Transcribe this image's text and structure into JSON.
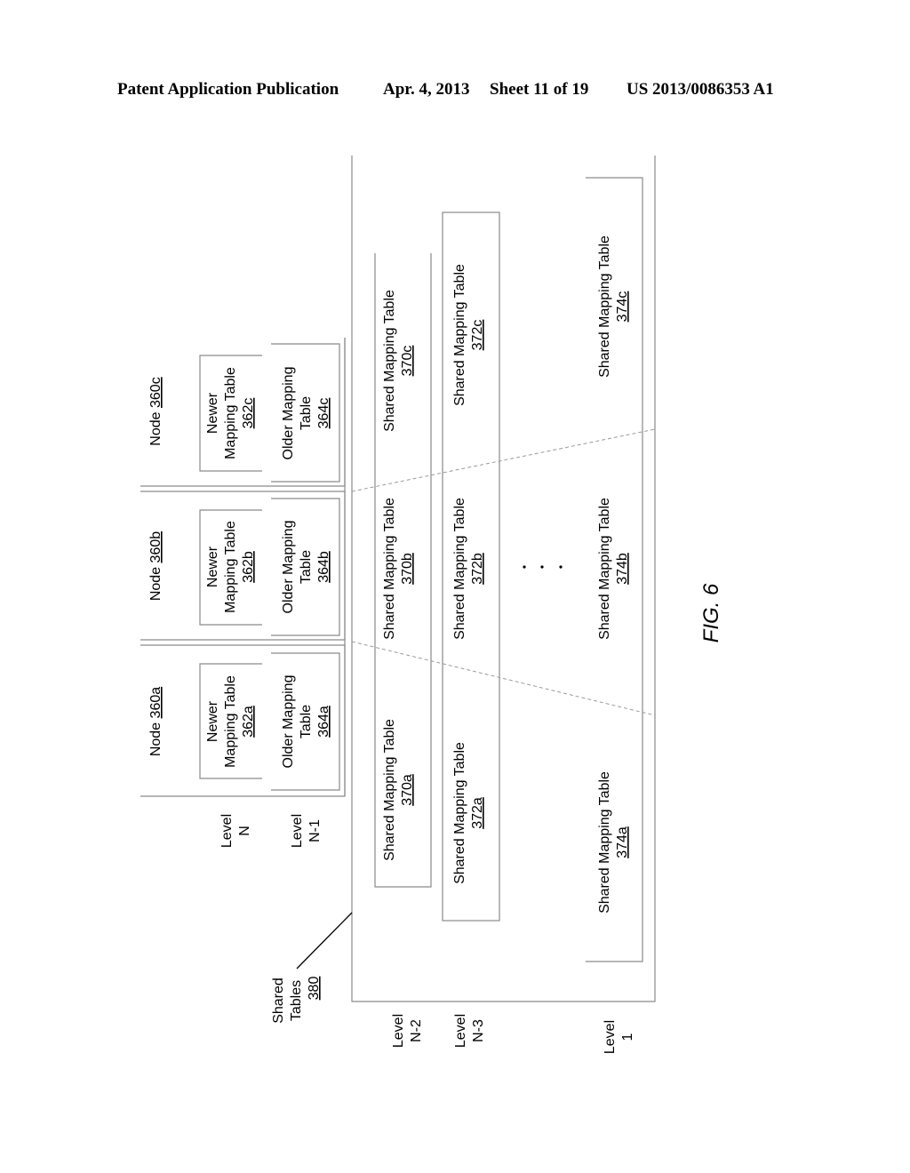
{
  "header": {
    "publication": "Patent Application Publication",
    "date": "Apr. 4, 2013",
    "sheet": "Sheet 11 of 19",
    "number": "US 2013/0086353 A1"
  },
  "figure_label": "FIG. 6",
  "nodes": [
    {
      "label": "Node",
      "ref": "360a",
      "newer": {
        "l1": "Newer",
        "l2": "Mapping Table",
        "ref": "362a"
      },
      "older": {
        "l1": "Older Mapping",
        "l2": "Table",
        "ref": "364a"
      }
    },
    {
      "label": "Node",
      "ref": "360b",
      "newer": {
        "l1": "Newer",
        "l2": "Mapping Table",
        "ref": "362b"
      },
      "older": {
        "l1": "Older Mapping",
        "l2": "Table",
        "ref": "364b"
      }
    },
    {
      "label": "Node",
      "ref": "360c",
      "newer": {
        "l1": "Newer",
        "l2": "Mapping Table",
        "ref": "362c"
      },
      "older": {
        "l1": "Older Mapping",
        "l2": "Table",
        "ref": "364c"
      }
    }
  ],
  "levels": [
    {
      "l1": "Level",
      "l2": "N"
    },
    {
      "l1": "Level",
      "l2": "N-1"
    },
    {
      "l1": "Level",
      "l2": "N-2"
    },
    {
      "l1": "Level",
      "l2": "N-3"
    },
    {
      "l1": "Level",
      "l2": "1"
    }
  ],
  "shared": {
    "l1": "Shared",
    "l2": "Tables",
    "ref": "380"
  },
  "shared_tables": {
    "label": "Shared Mapping Table",
    "row_n2": [
      "370a",
      "370b",
      "370c"
    ],
    "row_n3": [
      "372a",
      "372b",
      "372c"
    ],
    "row_1": [
      "374a",
      "374b",
      "374c"
    ]
  }
}
